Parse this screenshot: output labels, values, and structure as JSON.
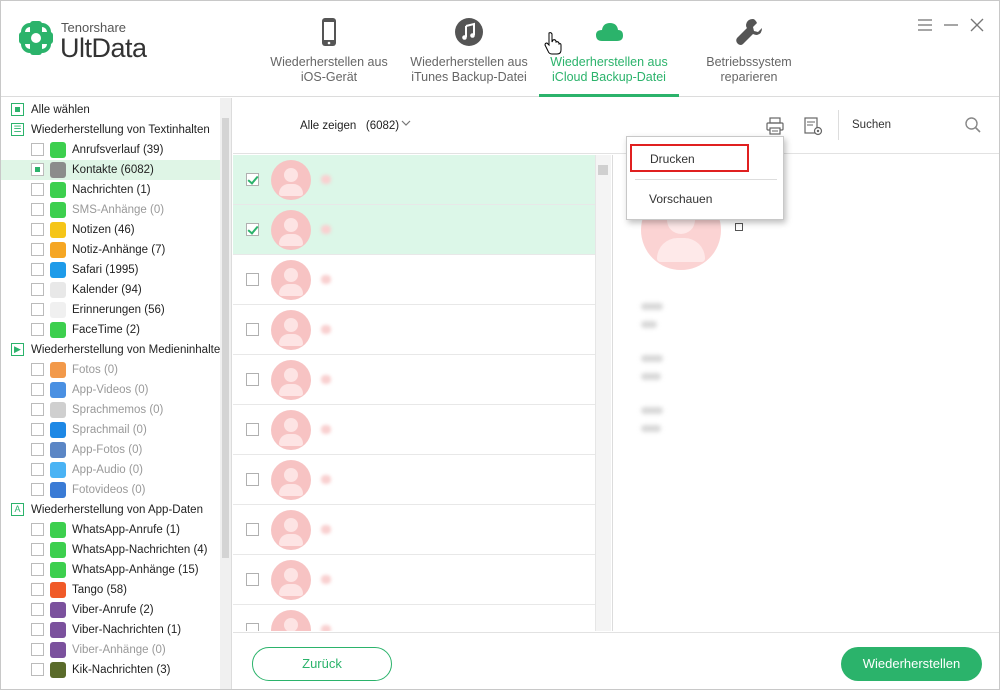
{
  "header": {
    "brand_small": "Tenorshare",
    "brand_big": "UltData",
    "tabs": [
      {
        "line1": "Wiederherstellen aus",
        "line2": "iOS-Gerät",
        "icon": "phone-icon"
      },
      {
        "line1": "Wiederherstellen aus",
        "line2": "iTunes Backup-Datei",
        "icon": "music-note-icon"
      },
      {
        "line1": "Wiederherstellen aus",
        "line2": "iCloud Backup-Datei",
        "icon": "cloud-icon",
        "active": true
      },
      {
        "line1": "Betriebssystem",
        "line2": "reparieren",
        "icon": "wrench-icon"
      }
    ]
  },
  "sidebar": {
    "select_all": "Alle wählen",
    "groups": [
      {
        "label": "Wiederherstellung von Textinhalten",
        "items": [
          {
            "label": "Anrufsverlauf (39)",
            "icon": "phone-call-icon",
            "color": "#3ccf4e"
          },
          {
            "label": "Kontakte (6082)",
            "icon": "contacts-icon",
            "color": "#8c8c8c",
            "selected": true
          },
          {
            "label": "Nachrichten (1)",
            "icon": "message-icon",
            "color": "#3ccf4e"
          },
          {
            "label": "SMS-Anhänge (0)",
            "icon": "attachment-icon",
            "color": "#3ccf4e",
            "disabled": true
          },
          {
            "label": "Notizen (46)",
            "icon": "notes-icon",
            "color": "#f5c518"
          },
          {
            "label": "Notiz-Anhänge (7)",
            "icon": "notes-attachment-icon",
            "color": "#f5a623"
          },
          {
            "label": "Safari (1995)",
            "icon": "safari-icon",
            "color": "#1e9be9"
          },
          {
            "label": "Kalender (94)",
            "icon": "calendar-icon",
            "color": "#e8e8e8"
          },
          {
            "label": "Erinnerungen (56)",
            "icon": "reminders-icon",
            "color": "#f0f0f0"
          },
          {
            "label": "FaceTime (2)",
            "icon": "facetime-icon",
            "color": "#3ccf4e"
          }
        ]
      },
      {
        "label": "Wiederherstellung von Medieninhalten",
        "items": [
          {
            "label": "Fotos (0)",
            "icon": "photos-icon",
            "color": "#f2994a",
            "disabled": true
          },
          {
            "label": "App-Videos (0)",
            "icon": "video-icon",
            "color": "#4a90e2",
            "disabled": true
          },
          {
            "label": "Sprachmemos (0)",
            "icon": "voice-memo-icon",
            "color": "#cfcfcf",
            "disabled": true
          },
          {
            "label": "Sprachmail (0)",
            "icon": "voicemail-icon",
            "color": "#1e88e5",
            "disabled": true
          },
          {
            "label": "App-Fotos (0)",
            "icon": "app-photos-icon",
            "color": "#5b86c5",
            "disabled": true
          },
          {
            "label": "App-Audio (0)",
            "icon": "microphone-icon",
            "color": "#4ab3f4",
            "disabled": true
          },
          {
            "label": "Fotovideos (0)",
            "icon": "photo-video-icon",
            "color": "#3a7bd5",
            "disabled": true
          }
        ]
      },
      {
        "label": "Wiederherstellung von App-Daten",
        "items": [
          {
            "label": "WhatsApp-Anrufe (1)",
            "icon": "whatsapp-call-icon",
            "color": "#3ccf4e"
          },
          {
            "label": "WhatsApp-Nachrichten (4)",
            "icon": "whatsapp-icon",
            "color": "#3ccf4e"
          },
          {
            "label": "WhatsApp-Anhänge (15)",
            "icon": "whatsapp-attachment-icon",
            "color": "#3ccf4e"
          },
          {
            "label": "Tango (58)",
            "icon": "tango-icon",
            "color": "#f05a28"
          },
          {
            "label": "Viber-Anrufe (2)",
            "icon": "viber-call-icon",
            "color": "#7b519d"
          },
          {
            "label": "Viber-Nachrichten (1)",
            "icon": "viber-icon",
            "color": "#7b519d"
          },
          {
            "label": "Viber-Anhänge (0)",
            "icon": "viber-attachment-icon",
            "color": "#7b519d",
            "disabled": true
          },
          {
            "label": "Kik-Nachrichten (3)",
            "icon": "kik-icon",
            "color": "#5a6b2b"
          }
        ]
      }
    ]
  },
  "toolbar": {
    "show_all": "Alle zeigen",
    "count": "(6082)",
    "search_label": "Suchen"
  },
  "list": {
    "rows": [
      {
        "checked": true
      },
      {
        "checked": true
      },
      {
        "checked": false
      },
      {
        "checked": false
      },
      {
        "checked": false
      },
      {
        "checked": false
      },
      {
        "checked": false
      },
      {
        "checked": false
      },
      {
        "checked": false
      },
      {
        "checked": false
      }
    ]
  },
  "menu": {
    "print": "Drucken",
    "preview": "Vorschauen"
  },
  "footer": {
    "back": "Zurück",
    "restore": "Wiederherstellen"
  },
  "colors": {
    "accent": "#2bb36b",
    "highlight": "#e02020"
  }
}
